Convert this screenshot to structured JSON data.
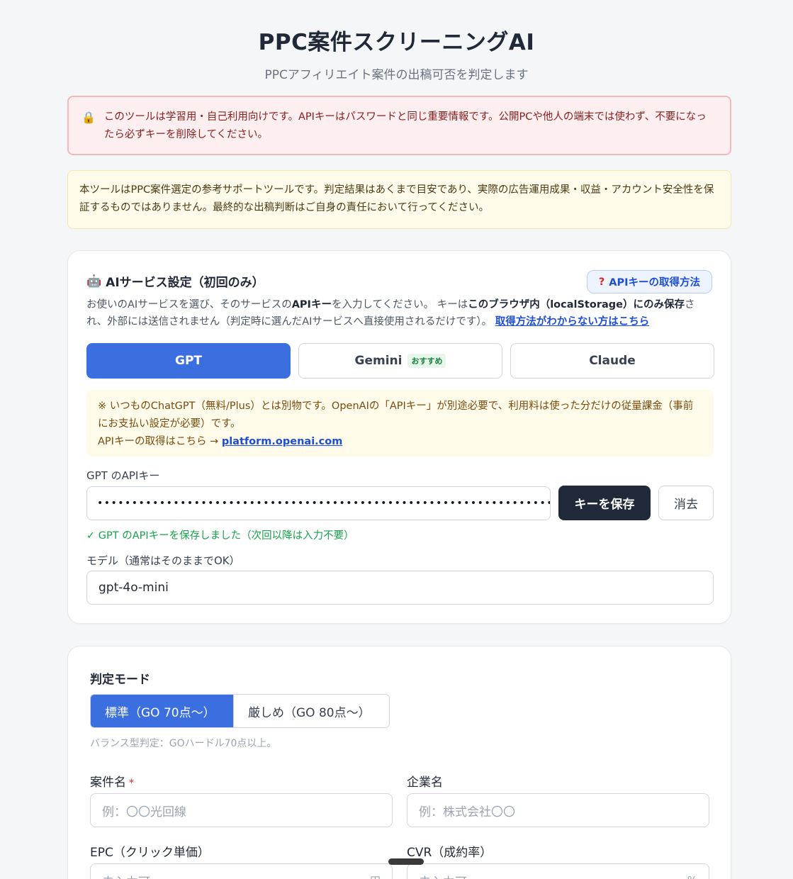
{
  "header": {
    "title": "PPC案件スクリーニングAI",
    "subtitle": "PPCアフィリエイト案件の出稿可否を判定します"
  },
  "security_warning": {
    "icon": "lock-icon",
    "text": "このツールは学習用・自己利用向けです。APIキーはパスワードと同じ重要情報です。公開PCや他人の端末では使わず、不要になったら必ずキーを削除してください。"
  },
  "disclaimer": {
    "text": "本ツールはPPC案件選定の参考サポートツールです。判定結果はあくまで目安であり、実際の広告運用成果・収益・アカウント安全性を保証するものではありません。最終的な出稿判断はご自身の責任において行ってください。"
  },
  "ai_settings": {
    "icon": "robot-icon",
    "title": "AIサービス設定（初回のみ）",
    "help_button": "APIキーの取得方法",
    "help_icon": "question-icon",
    "desc_part1": "お使いのAIサービスを選び、そのサービスの",
    "desc_bold1": "APIキー",
    "desc_part2": "を入力してください。 キーは",
    "desc_bold2": "このブラウザ内（localStorage）にのみ保存",
    "desc_part3": "され、外部には送信されません（判定時に選んだAIサービスへ直接使用されるだけです）。",
    "desc_link": "取得方法がわからない方はこちら",
    "services": [
      {
        "label": "GPT",
        "active": true
      },
      {
        "label": "Gemini",
        "badge": "おすすめ",
        "active": false
      },
      {
        "label": "Claude",
        "active": false
      }
    ],
    "gpt_note_line1": "※ いつものChatGPT（無料/Plus）とは別物です。OpenAIの「APIキー」が別途必要で、利用料は使った分だけの従量課金（事前にお支払い設定が必要）です。",
    "gpt_note_prefix": "APIキーの取得はこちら →",
    "gpt_note_link": "platform.openai.com",
    "key_label": "GPT のAPIキー",
    "key_value": "••••••••••••••••••••••••••••••••••••••••••••••••••••••••••••••••••••••••••••••••••••",
    "save_button": "キーを保存",
    "clear_button": "消去",
    "saved_message": "✓ GPT のAPIキーを保存しました（次回以降は入力不要）",
    "model_label": "モデル（通常はそのままでOK）",
    "model_value": "gpt-4o-mini"
  },
  "judge": {
    "mode_title": "判定モード",
    "modes": [
      "標準（GO 70点〜）",
      "厳しめ（GO 80点〜）"
    ],
    "mode_hint": "バランス型判定：GOハードル70点以上。",
    "fields": {
      "case_name_label": "案件名",
      "case_name_required": "*",
      "case_name_placeholder": "例：〇〇光回線",
      "company_label": "企業名",
      "company_placeholder": "例：株式会社〇〇",
      "epc_label": "EPC（クリック単価）",
      "epc_placeholder": "未入力可",
      "epc_unit": "円",
      "cvr_label": "CVR（成約率）",
      "cvr_placeholder": "未入力可",
      "cvr_unit": "%"
    }
  },
  "colors": {
    "accent": "#3b6fe0",
    "dark_button": "#1f2937",
    "success": "#16a34a",
    "link": "#1d4ed8",
    "danger": "#dc2626"
  }
}
